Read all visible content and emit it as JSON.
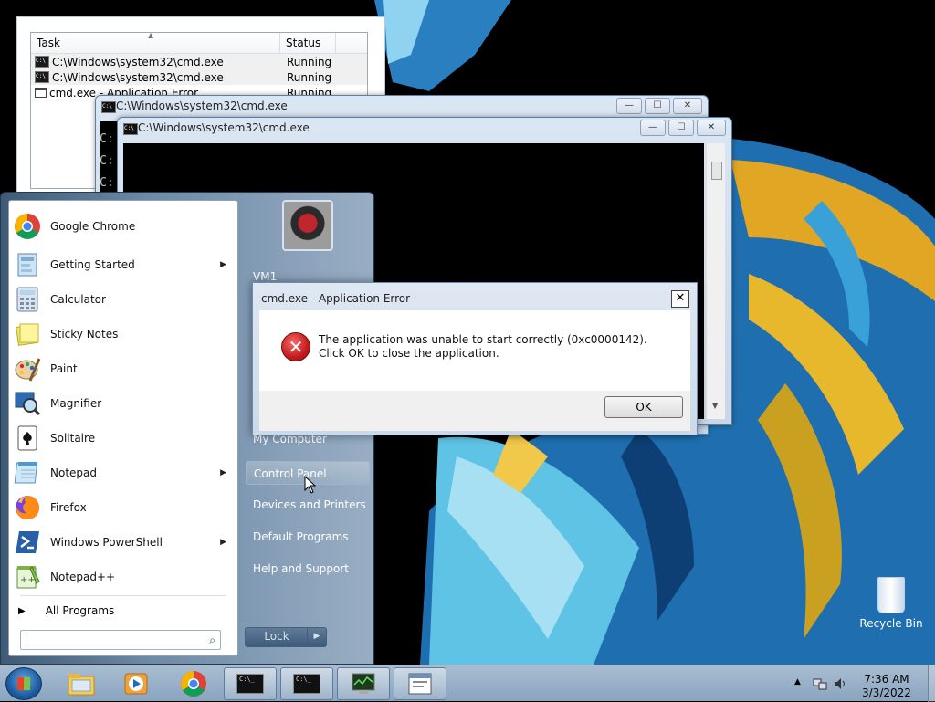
{
  "taskmgr": {
    "col_task": "Task",
    "col_status": "Status",
    "rows": [
      {
        "task": "C:\\Windows\\system32\\cmd.exe",
        "status": "Running"
      },
      {
        "task": "C:\\Windows\\system32\\cmd.exe",
        "status": "Running"
      },
      {
        "task": "cmd.exe - Application Error",
        "status": "Running"
      }
    ]
  },
  "cmd_back": {
    "title": "C:\\Windows\\system32\\cmd.exe",
    "prompts": [
      "C:",
      "C:",
      "C:"
    ]
  },
  "cmd_front": {
    "title": "C:\\Windows\\system32\\cmd.exe"
  },
  "window_controls": {
    "minimize": "—",
    "maximize": "☐",
    "close": "✕"
  },
  "start_menu": {
    "pinned": [
      {
        "label": "Google Chrome",
        "icon": "chrome-icon",
        "submenu": false
      },
      {
        "label": "Getting Started",
        "icon": "getting-started-icon",
        "submenu": true
      },
      {
        "label": "Calculator",
        "icon": "calculator-icon",
        "submenu": false
      },
      {
        "label": "Sticky Notes",
        "icon": "sticky-notes-icon",
        "submenu": false
      },
      {
        "label": "Paint",
        "icon": "paint-icon",
        "submenu": false
      },
      {
        "label": "Magnifier",
        "icon": "magnifier-icon",
        "submenu": false
      },
      {
        "label": "Solitaire",
        "icon": "solitaire-icon",
        "submenu": false
      },
      {
        "label": "Notepad",
        "icon": "notepad-icon",
        "submenu": true
      },
      {
        "label": "Firefox",
        "icon": "firefox-icon",
        "submenu": false
      },
      {
        "label": "Windows PowerShell",
        "icon": "powershell-icon",
        "submenu": true
      },
      {
        "label": "Notepad++",
        "icon": "notepadpp-icon",
        "submenu": false
      }
    ],
    "all_programs": "All Programs",
    "search_placeholder": "",
    "right": {
      "user": "VM1",
      "items": [
        "My Computer",
        "Control Panel",
        "Devices and Printers",
        "Default Programs",
        "Help and Support"
      ]
    },
    "lock_label": "Lock"
  },
  "error_dialog": {
    "title": "cmd.exe - Application Error",
    "message": "The application was unable to start correctly (0xc0000142). Click OK to close the application.",
    "ok_label": "OK",
    "close_glyph": "✕"
  },
  "desktop": {
    "recycle_bin": "Recycle Bin"
  },
  "taskbar": {
    "pinned": [
      "explorer-icon",
      "media-player-icon",
      "chrome-icon",
      "cmd-icon",
      "cmd-icon",
      "task-manager-icon",
      "dialog-icon"
    ],
    "clock_time": "7:36 AM",
    "clock_date": "3/3/2022"
  },
  "colors": {
    "error_red": "#c51c1c",
    "taskbar": "#8aa4bf",
    "start_menu_right": "#6d8aa6"
  }
}
